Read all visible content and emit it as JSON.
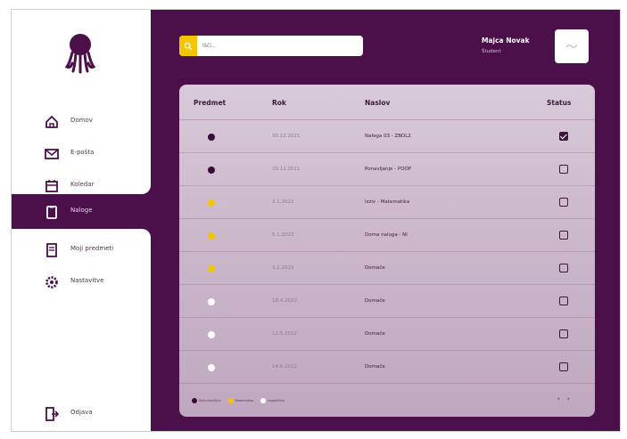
{
  "colors": {
    "sidebar_bg": "#ffffff",
    "main_bg": "#4b0f4a",
    "accent_yellow": "#f2c500",
    "dot_dark": "#3a0a3a",
    "dot_yellow": "#f2c500",
    "dot_white": "#ffffff"
  },
  "sidebar": {
    "logo_icon": "octopus-logo-icon",
    "items": [
      {
        "icon": "home-icon",
        "label": "Domov"
      },
      {
        "icon": "mail-icon",
        "label": "E-pošta"
      },
      {
        "icon": "calendar-icon",
        "label": "Koledar"
      },
      {
        "icon": "clipboard-icon",
        "label": "Naloge",
        "active": true
      },
      {
        "icon": "book-icon",
        "label": "Moji predmeti"
      },
      {
        "icon": "gear-icon",
        "label": "Nastavitve"
      }
    ],
    "logout": {
      "icon": "logout-icon",
      "label": "Odjava"
    }
  },
  "search": {
    "placeholder": "Išči...",
    "icon": "search-icon"
  },
  "user": {
    "name": "Majca Novak",
    "role": "Študent",
    "avatar_icon": "avatar-icon"
  },
  "table": {
    "columns": [
      "Predmet",
      "Rok",
      "Naslov",
      "Status"
    ],
    "rows": [
      {
        "dot": "dark",
        "date": "30.12.2021",
        "title": "Naloga 03 - ZBOL2",
        "checked": true
      },
      {
        "dot": "dark",
        "date": "29.12.2021",
        "title": "Ponavljanje - POOP",
        "checked": false
      },
      {
        "dot": "yellow",
        "date": "3.1.2022",
        "title": "Izziv - Matematika",
        "checked": false
      },
      {
        "dot": "yellow",
        "date": "5.1.2022",
        "title": "Doma naloga - NI",
        "checked": false
      },
      {
        "dot": "yellow",
        "date": "3.2.2022",
        "title": "Domače",
        "checked": false
      },
      {
        "dot": "white",
        "date": "18.4.2022",
        "title": "Domače",
        "checked": false
      },
      {
        "dot": "white",
        "date": "12.5.2022",
        "title": "Domače",
        "checked": false
      },
      {
        "dot": "white",
        "date": "14.6.2022",
        "title": "Domače",
        "checked": false
      }
    ]
  },
  "legend": [
    {
      "dot": "dark",
      "label": "Računalništvo"
    },
    {
      "dot": "yellow",
      "label": "Matematika"
    },
    {
      "dot": "white",
      "label": "Angleščina"
    }
  ],
  "pager": {
    "prev": "‹",
    "next": "›"
  }
}
